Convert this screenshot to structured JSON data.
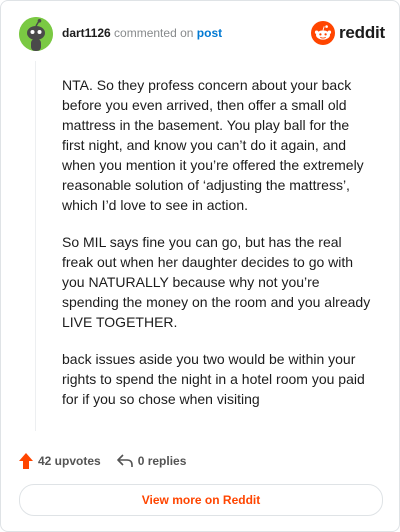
{
  "comment": {
    "username": "dart1126",
    "action_text": "commented on",
    "post_link": "post",
    "paragraphs": [
      "NTA. So they profess concern about your back before you even arrived, then offer a small old mattress in the basement. You play ball for the first night, and know you can’t do it again, and when you mention it you’re offered the extremely reasonable solution of ‘adjusting the mattress’, which I’d love to see in action.",
      "So MIL says fine you can go, but has the real freak out when her daughter decides to go with you NATURALLY because why not you’re spending the money on the room and you already LIVE TOGETHER.",
      "back issues aside you two would be within your rights to spend the night in a hotel room you paid for if you so chose when visiting"
    ]
  },
  "brand": {
    "name": "reddit",
    "color": "#ff4500"
  },
  "footer": {
    "upvotes": "42 upvotes",
    "replies": "0 replies"
  },
  "view_more": "View more on Reddit",
  "colors": {
    "accent": "#ff4500",
    "link": "#0079d3",
    "avatar_bg": "#7ac943"
  }
}
